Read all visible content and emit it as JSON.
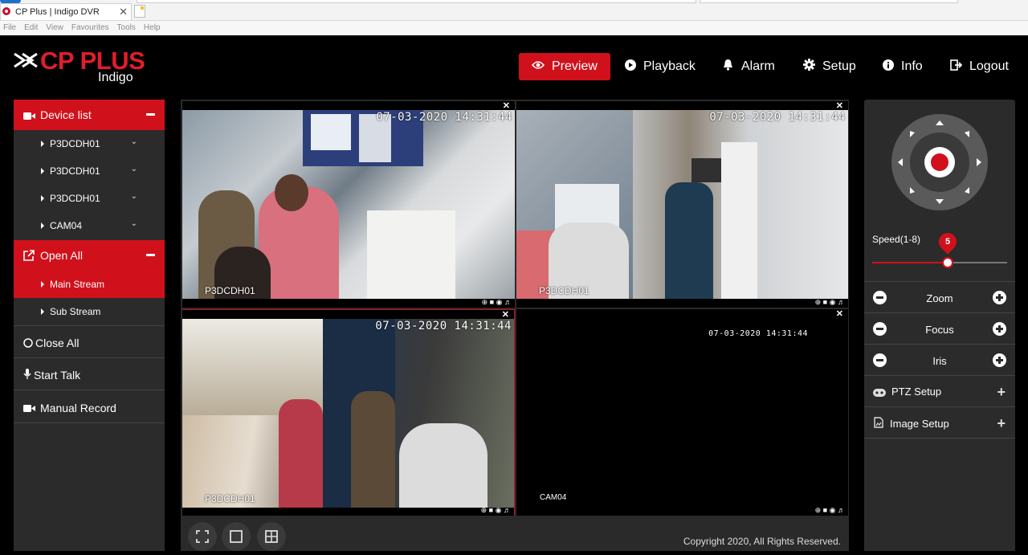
{
  "browser": {
    "tab_title": "CP Plus | Indigo DVR",
    "menu": [
      "File",
      "Edit",
      "View",
      "Favourites",
      "Tools",
      "Help"
    ]
  },
  "brand": {
    "name": "CP PLUS",
    "sub": "Indigo"
  },
  "nav": {
    "preview": "Preview",
    "playback": "Playback",
    "alarm": "Alarm",
    "setup": "Setup",
    "info": "Info",
    "logout": "Logout"
  },
  "left_panel": {
    "device_list": "Device list",
    "devices": [
      "P3DCDH01",
      "P3DCDH01",
      "P3DCDH01",
      "CAM04"
    ],
    "open_all": "Open All",
    "main_stream": "Main Stream",
    "sub_stream": "Sub Stream",
    "close_all": "Close All",
    "start_talk": "Start Talk",
    "manual_record": "Manual Record"
  },
  "cameras": [
    {
      "timestamp": "07-03-2020 14:31:44",
      "name": "P3DCDH01"
    },
    {
      "timestamp": "07-03-2020 14:31:44",
      "name": "P3DCDH01"
    },
    {
      "timestamp": "07-03-2020 14:31:44",
      "name": "P3DCDH01"
    },
    {
      "timestamp": "07-03-2020 14:31:44",
      "name": "CAM04"
    }
  ],
  "footer": {
    "copyright": "Copyright 2020, All Rights Reserved."
  },
  "ptz": {
    "speed_label": "Speed(1-8)",
    "speed_value": "5",
    "speed_fraction": 0.56,
    "zoom": "Zoom",
    "focus": "Focus",
    "iris": "Iris",
    "ptz_setup": "PTZ Setup",
    "image_setup": "Image Setup"
  },
  "colors": {
    "accent": "#d0111b",
    "panel": "#2b2b2b",
    "background": "#000000"
  }
}
